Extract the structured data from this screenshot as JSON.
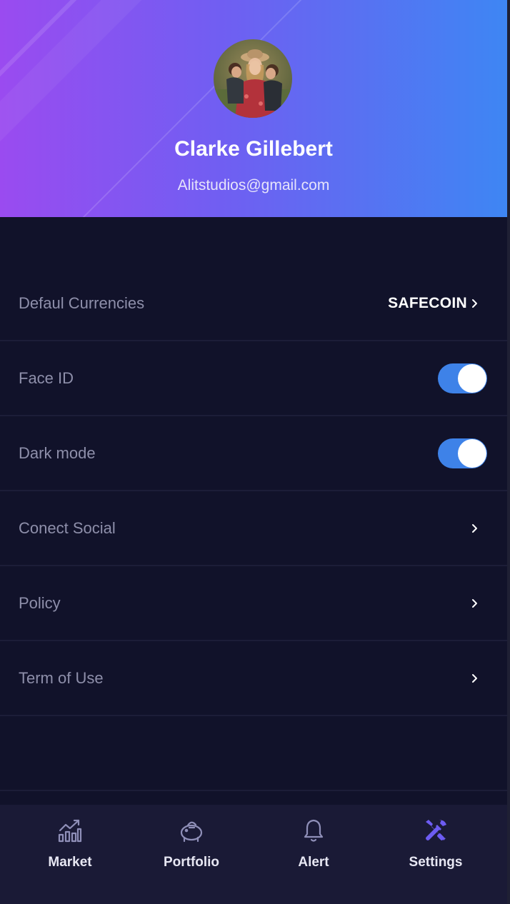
{
  "profile": {
    "name": "Clarke Gillebert",
    "email": "Alitstudios@gmail.com"
  },
  "settings": {
    "default_currency_label": "Defaul Currencies",
    "default_currency_value": "SAFECOIN",
    "face_id_label": "Face ID",
    "face_id_on": true,
    "dark_mode_label": "Dark mode",
    "dark_mode_on": true,
    "connect_social_label": "Conect Social",
    "policy_label": "Policy",
    "terms_label": "Term of Use"
  },
  "tabbar": {
    "tabs": [
      {
        "label": "Market",
        "icon": "chart-icon",
        "active": false
      },
      {
        "label": "Portfolio",
        "icon": "piggy-bank-icon",
        "active": false
      },
      {
        "label": "Alert",
        "icon": "bell-icon",
        "active": false
      },
      {
        "label": "Settings",
        "icon": "tools-icon",
        "active": true
      }
    ]
  },
  "colors": {
    "background": "#11122a",
    "gradient_start": "#9a4bf0",
    "gradient_end": "#3e86f3",
    "toggle_on": "#3e82e8",
    "active_tab": "#6d5cf2",
    "inactive_icon": "#8f8fb8"
  }
}
